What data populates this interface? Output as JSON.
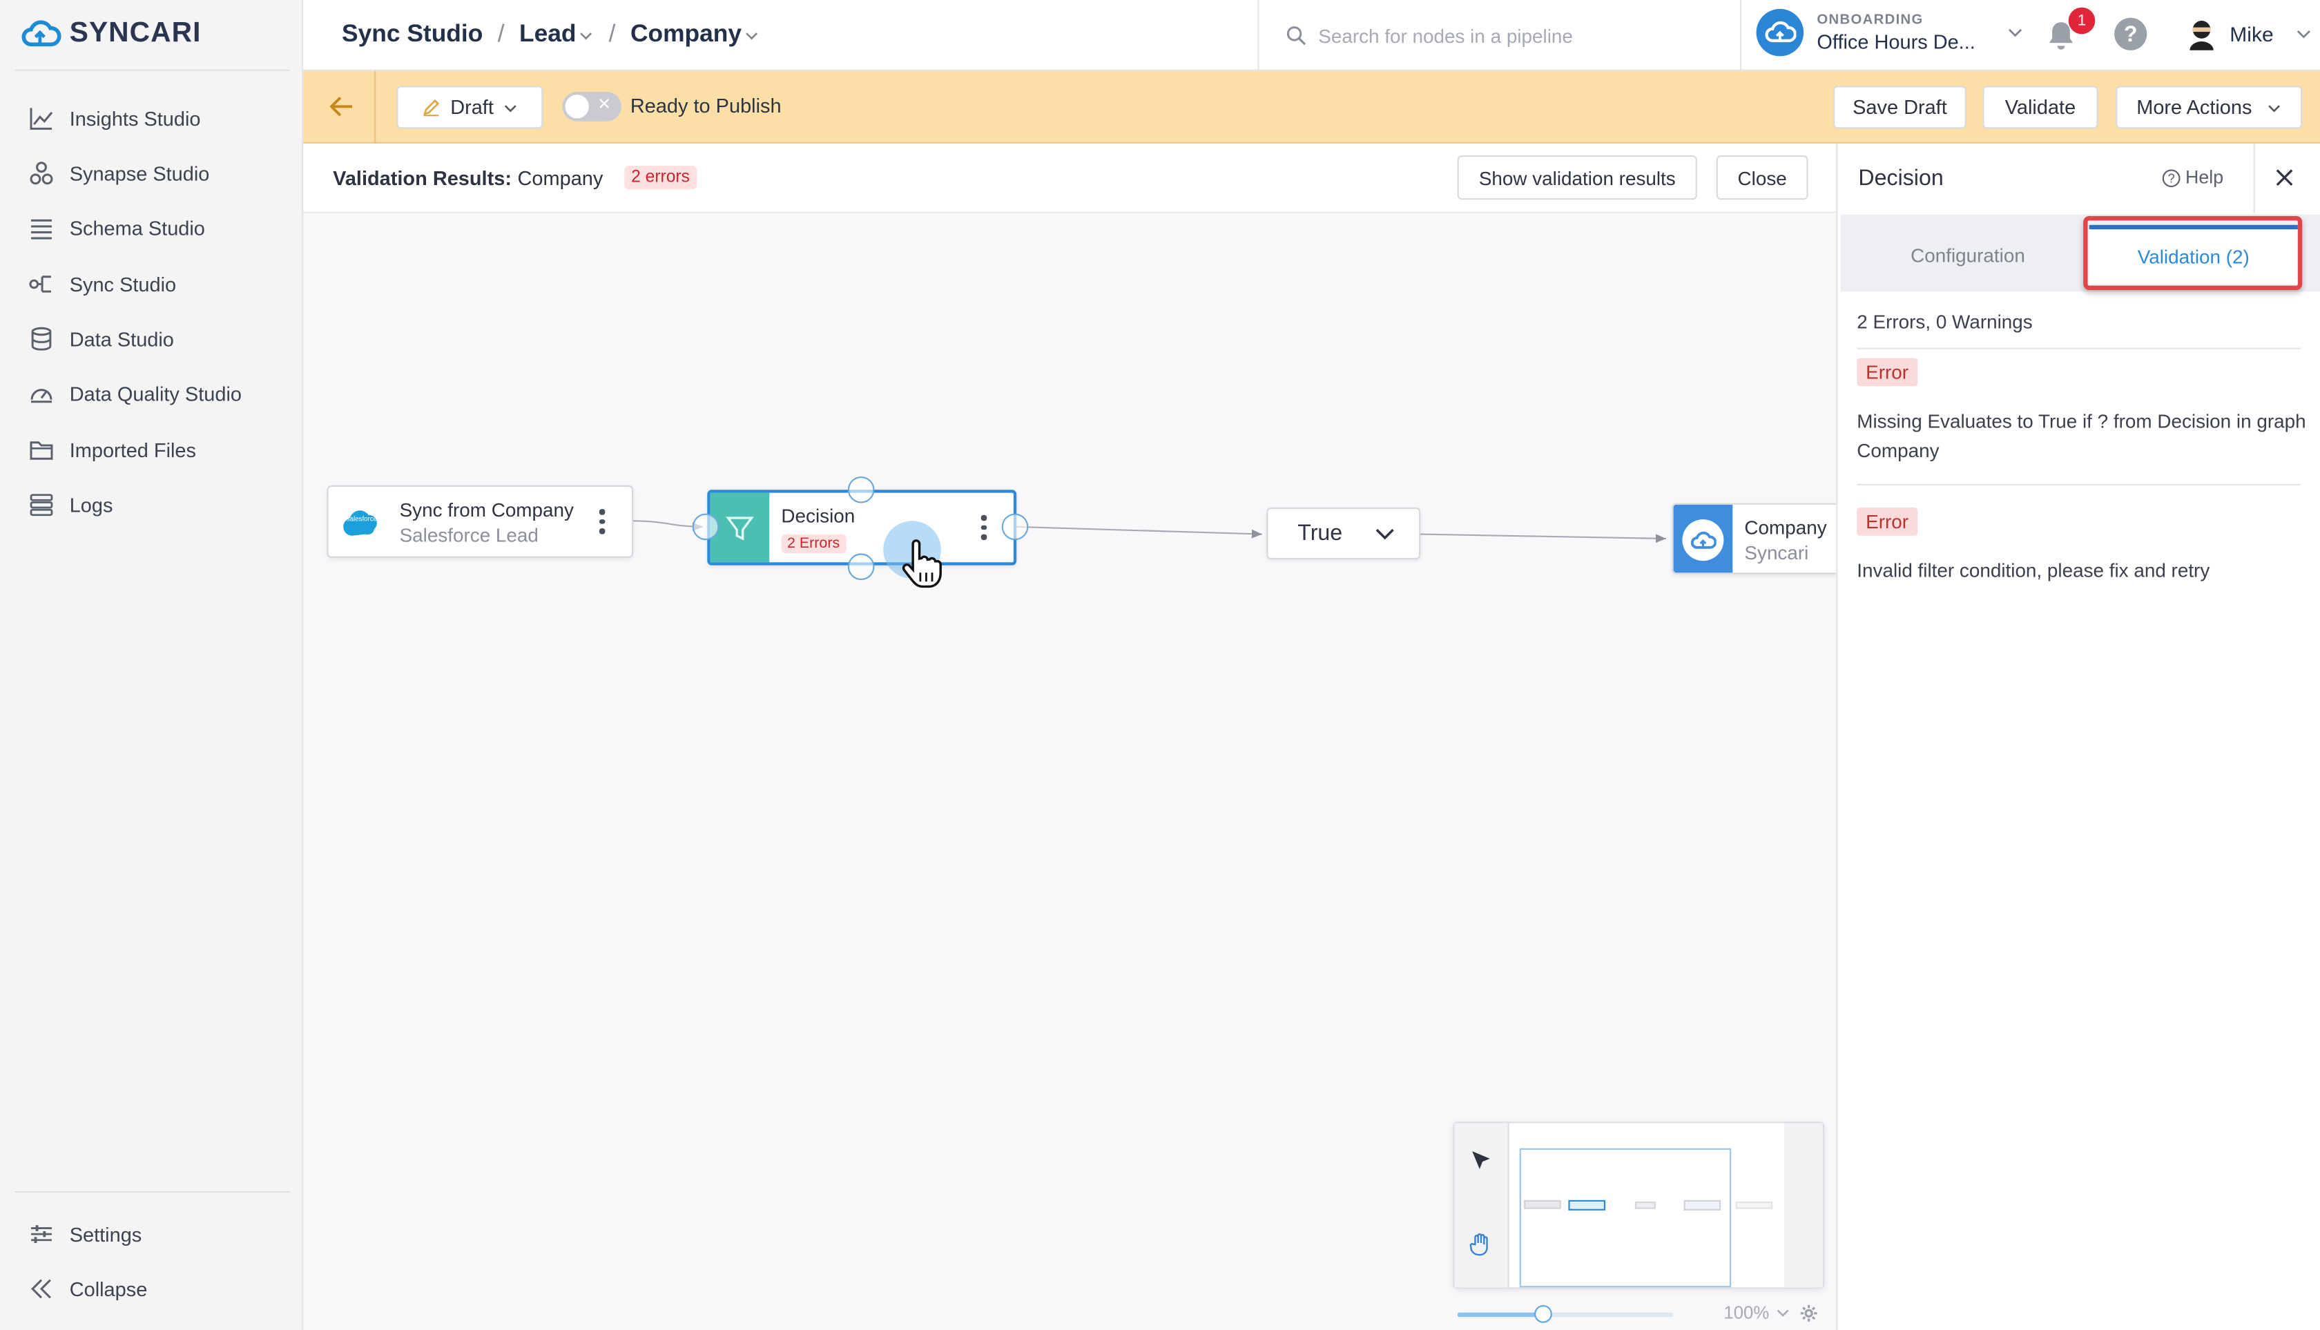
{
  "app": {
    "name": "SYNCARI"
  },
  "sidebar": {
    "items": [
      {
        "label": "Insights Studio",
        "icon": "chart-icon"
      },
      {
        "label": "Synapse Studio",
        "icon": "synapse-icon"
      },
      {
        "label": "Schema Studio",
        "icon": "list-icon"
      },
      {
        "label": "Sync Studio",
        "icon": "sync-icon"
      },
      {
        "label": "Data Studio",
        "icon": "database-icon"
      },
      {
        "label": "Data Quality Studio",
        "icon": "gauge-icon"
      },
      {
        "label": "Imported Files",
        "icon": "folder-icon"
      },
      {
        "label": "Logs",
        "icon": "logs-icon"
      }
    ],
    "settings_label": "Settings",
    "collapse_label": "Collapse"
  },
  "header": {
    "breadcrumb": [
      "Sync Studio",
      "Lead",
      "Company"
    ],
    "search_placeholder": "Search for nodes in a pipeline",
    "org_label": "ONBOARDING",
    "org_name": "Office Hours De...",
    "notification_count": "1",
    "help_label": "?",
    "user_name": "Mike"
  },
  "toolbar": {
    "draft_label": "Draft",
    "publish_label": "Ready to Publish",
    "save_draft_label": "Save Draft",
    "validate_label": "Validate",
    "more_actions_label": "More Actions"
  },
  "validation_bar": {
    "title": "Validation Results:",
    "entity": "Company",
    "errors_badge": "2 errors",
    "show_results_label": "Show validation results",
    "close_label": "Close"
  },
  "canvas": {
    "nodes": {
      "source": {
        "title": "Sync from Company",
        "subtitle": "Salesforce Lead",
        "logo_text": "salesforce"
      },
      "decision": {
        "title": "Decision",
        "badge": "2 Errors"
      },
      "branch": {
        "label": "True"
      },
      "target": {
        "title": "Company",
        "subtitle": "Syncari"
      }
    },
    "zoom_level": "100%",
    "zoom_fraction": 0.4
  },
  "panel": {
    "title": "Decision",
    "help_label": "Help",
    "tabs": [
      "Configuration",
      "Validation (2)"
    ],
    "active_tab": "Validation (2)",
    "summary": "2 Errors, 0 Warnings",
    "errors": [
      {
        "tag": "Error",
        "message": "Missing Evaluates to True if ? from Decision in graph Company"
      },
      {
        "tag": "Error",
        "message": "Invalid filter condition, please fix and retry"
      }
    ]
  },
  "colors": {
    "brand": "#1d8cd6",
    "toolbar_bg": "#fcdfa6",
    "error": "#c8252f",
    "decision_accent": "#4cbfb3",
    "highlight": "#e0454a"
  }
}
